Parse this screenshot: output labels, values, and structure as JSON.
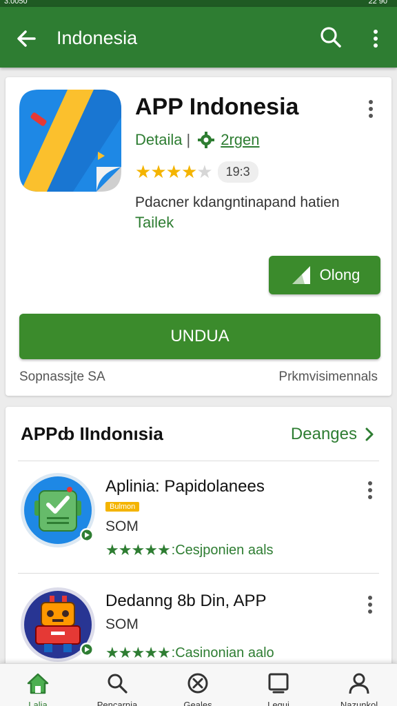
{
  "status_bar": {
    "left": "3:0050",
    "right": "22 90"
  },
  "app_bar": {
    "title": "Indonesia"
  },
  "app": {
    "title": "APP Indonesia",
    "category": "Detaila",
    "separator": "|",
    "rank": "2rgen",
    "rating": 4,
    "rating_badge": "19:3",
    "description": "Pdacner kdangntinapand hatien",
    "description_sub": "Tailek",
    "open_label": "Olong",
    "install_label": "UNDUA",
    "footer_left": "Sopnassjte SA",
    "footer_right": "Prkmvisimennals"
  },
  "section": {
    "title": "APPȸ IIndonısia",
    "link_label": "Deanges",
    "items": [
      {
        "name": "Aplinia: Papidolanees",
        "tag": "Bulmon",
        "size": "SOM",
        "rating": 5,
        "rating_text": ":Cesjponien aals"
      },
      {
        "name": "Dedanng 8b Din, APP",
        "tag": "",
        "size": "SOM",
        "rating": 5,
        "rating_text": ":Casinonian aalo"
      }
    ]
  },
  "bottom_nav": [
    {
      "icon": "home-icon",
      "label": "Lalia",
      "active": true
    },
    {
      "icon": "search-icon",
      "label": "Pencarnia",
      "active": false
    },
    {
      "icon": "close-circle-icon",
      "label": "Geales",
      "active": false
    },
    {
      "icon": "tablet-icon",
      "label": "Lequi",
      "active": false
    },
    {
      "icon": "person-icon",
      "label": "Nazunkol",
      "active": false
    }
  ],
  "colors": {
    "primary": "#2e7d32",
    "button": "#3b8b2c",
    "star": "#f4b400",
    "background": "#ececec"
  }
}
